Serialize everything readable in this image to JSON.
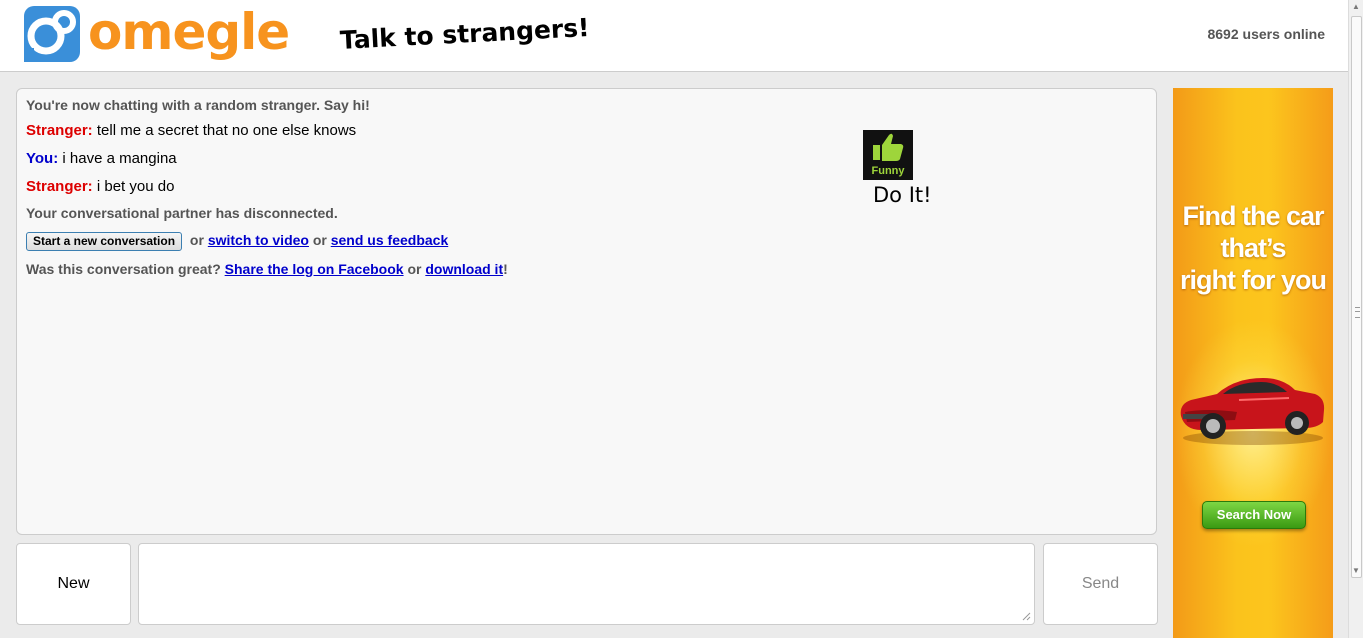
{
  "header": {
    "logo_text": "omegle",
    "tagline": "Talk to strangers!",
    "online_count": "8692",
    "online_suffix": " users online"
  },
  "chat": {
    "intro": "You're now chatting with a random stranger. Say hi!",
    "messages": [
      {
        "sender": "Stranger:",
        "text": " tell me a secret that no one else knows"
      },
      {
        "sender": "You:",
        "text": " i have a mangina"
      },
      {
        "sender": "Stranger:",
        "text": " i bet you do"
      }
    ],
    "disconnected": "Your conversational partner has disconnected.",
    "new_convo_button": "Start a new conversation",
    "or1": " or ",
    "switch_video": "switch to video",
    "or2": " or ",
    "feedback": "send us feedback",
    "great_question": "Was this conversation great? ",
    "share_facebook": "Share the log on Facebook",
    "or3": " or ",
    "download": "download it",
    "exclaim": "!",
    "funny_badge": "Funny",
    "doit": "Do It!"
  },
  "controls": {
    "new_label": "New",
    "message_value": "",
    "send_label": "Send"
  },
  "ad": {
    "headline_lines": [
      "Find the car",
      "that’s",
      "right for you"
    ],
    "search_label": "Search Now"
  },
  "colors": {
    "brand_orange": "#f7931e",
    "brand_blue": "#3a8fd9",
    "stranger_red": "#dd0000",
    "you_blue": "#0000cc"
  }
}
